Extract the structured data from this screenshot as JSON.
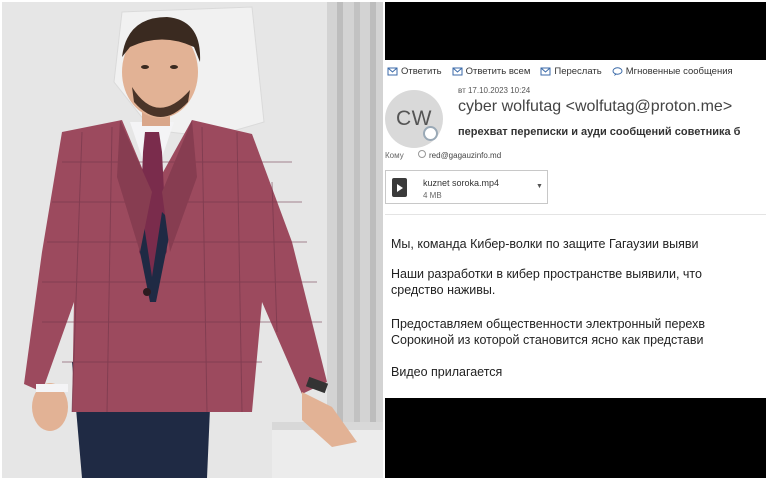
{
  "email": {
    "toolbar": {
      "reply": "Ответить",
      "reply_all": "Ответить всем",
      "forward": "Переслать",
      "instant_messages": "Мгновенные сообщения"
    },
    "date": "вт 17.10.2023 10:24",
    "avatar_initials": "CW",
    "sender": "cyber wolfutag <wolfutag@proton.me>",
    "subject": "перехват переписки и ауди сообщений советника б",
    "to_label": "Кому",
    "to_address": "red@gagauzinfo.md",
    "attachment": {
      "name": "kuznet soroka.mp4",
      "size": "4 MB"
    },
    "body": {
      "line1": "Мы, команда Кибер-волки по защите Гагаузии выяви",
      "line2": "Наши разработки в кибер пространстве выявили, что",
      "line3": "средство наживы.",
      "line4": "Предоставляем общественности электронный перехв",
      "line5": "Сорокиной из которой становится ясно как представи",
      "line6": "Видео прилагается"
    }
  },
  "colors": {
    "jacket": "#9c4a5e",
    "tie": "#7a2c4c",
    "screen_background": "#000000"
  }
}
